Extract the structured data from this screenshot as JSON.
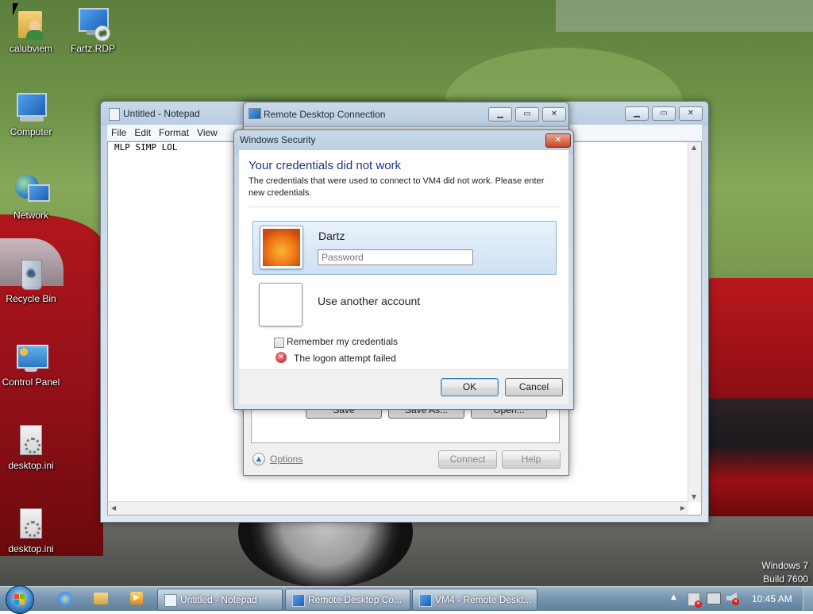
{
  "desktop": {
    "icons": [
      {
        "label": "calubviem",
        "icon": "user-folder-icon"
      },
      {
        "label": "Fartz.RDP",
        "icon": "rdp-file-icon"
      },
      {
        "label": "Computer",
        "icon": "computer-icon"
      },
      {
        "label": "Network",
        "icon": "network-icon"
      },
      {
        "label": "Recycle Bin",
        "icon": "recycle-bin-icon"
      },
      {
        "label": "Control Panel",
        "icon": "control-panel-icon"
      },
      {
        "label": "desktop.ini",
        "icon": "ini-file-icon"
      },
      {
        "label": "desktop.ini",
        "icon": "ini-file-icon"
      }
    ],
    "watermark": {
      "line1": "Windows 7",
      "line2": "Build 7600"
    }
  },
  "notepad": {
    "title": "Untitled - Notepad",
    "menu": [
      "File",
      "Edit",
      "Format",
      "View"
    ],
    "content": "MLP SIMP LOL"
  },
  "rdp": {
    "title": "Remote Desktop Connection",
    "ghost_buttons": [
      "Save",
      "Save As...",
      "Open..."
    ],
    "options_label": "Options",
    "connect_label": "Connect",
    "help_label": "Help"
  },
  "security": {
    "title": "Windows Security",
    "heading": "Your credentials did not work",
    "message": "The credentials that were used to connect to VM4 did not work. Please enter new credentials.",
    "user_name": "Dartz",
    "password_placeholder": "Password",
    "other_account_label": "Use another account",
    "remember_label": "Remember my credentials",
    "remember_checked": false,
    "error_text": "The logon attempt failed",
    "ok_label": "OK",
    "cancel_label": "Cancel",
    "heading_color": "#1e3287"
  },
  "taskbar": {
    "tasks": [
      {
        "label": "Untitled - Notepad",
        "icon": "notepad-icon"
      },
      {
        "label": "Remote Desktop Co...",
        "icon": "rdp-icon"
      },
      {
        "label": "VM4 - Remote Deskt...",
        "icon": "rdp-session-icon"
      }
    ],
    "pinned": [
      "internet-explorer-icon",
      "windows-explorer-icon",
      "media-player-icon"
    ],
    "clock": "10:45 AM"
  }
}
